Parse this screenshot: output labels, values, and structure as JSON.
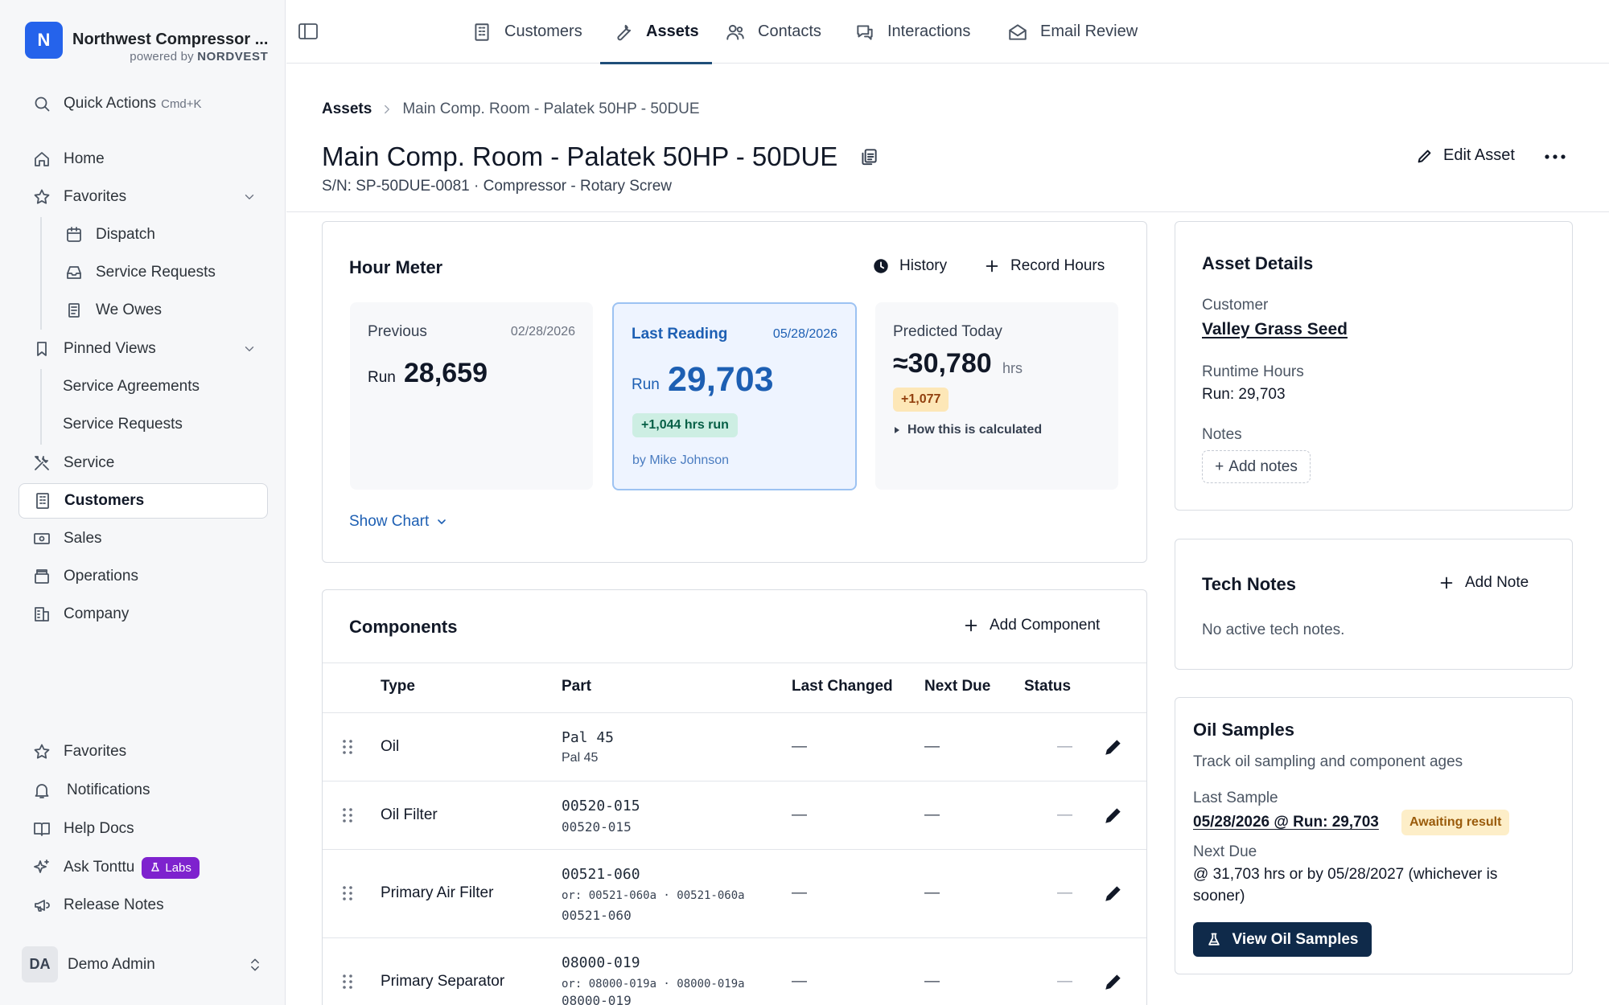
{
  "brand": {
    "logo_letter": "N",
    "name": "Northwest Compressor ...",
    "powered_prefix": "powered by",
    "powered_brand": "NORDVEST",
    "accent": "#2563eb"
  },
  "sidebar": {
    "quick_actions": {
      "label": "Quick Actions",
      "shortcut": "Cmd+K"
    },
    "home": "Home",
    "favorites": "Favorites",
    "favorites_items": [
      "Dispatch",
      "Service Requests",
      "We Owes"
    ],
    "pinned_views": "Pinned Views",
    "pinned_items": [
      "Service Agreements",
      "Service Requests"
    ],
    "service": "Service",
    "customers": "Customers",
    "sales": "Sales",
    "operations": "Operations",
    "company": "Company",
    "bottom": {
      "favorites": "Favorites",
      "notifications": "Notifications",
      "help_docs": "Help Docs",
      "ask": "Ask Tonttu",
      "labs_badge": "Labs",
      "release_notes": "Release Notes"
    },
    "user": {
      "initials": "DA",
      "name": "Demo Admin"
    }
  },
  "topnav": {
    "tabs": [
      {
        "label": "Customers",
        "icon": "building-icon"
      },
      {
        "label": "Assets",
        "icon": "wrench-icon",
        "active": true
      },
      {
        "label": "Contacts",
        "icon": "users-icon"
      },
      {
        "label": "Interactions",
        "icon": "chat-icon"
      },
      {
        "label": "Email Review",
        "icon": "mail-open-icon"
      }
    ]
  },
  "breadcrumb": {
    "root": "Assets",
    "current": "Main Comp. Room - Palatek 50HP - 50DUE"
  },
  "header": {
    "title": "Main Comp. Room - Palatek 50HP - 50DUE",
    "subtitle": "S/N: SP-50DUE-0081 · Compressor - Rotary Screw",
    "edit_label": "Edit Asset"
  },
  "hour_meter": {
    "title": "Hour Meter",
    "history_label": "History",
    "record_label": "Record Hours",
    "previous": {
      "label": "Previous",
      "date": "02/28/2026",
      "run_label": "Run",
      "value": "28,659"
    },
    "last": {
      "label": "Last Reading",
      "date": "05/28/2026",
      "run_label": "Run",
      "value": "29,703",
      "delta": "+1,044 hrs run",
      "by": "by Mike Johnson"
    },
    "predicted": {
      "label": "Predicted Today",
      "value": "≈30,780",
      "unit": "hrs",
      "delta": "+1,077",
      "how": "How this is calculated"
    },
    "show_chart": "Show Chart"
  },
  "components": {
    "title": "Components",
    "add_label": "Add Component",
    "columns": [
      "Type",
      "Part",
      "Last Changed",
      "Next Due",
      "Status"
    ],
    "rows": [
      {
        "type": "Oil",
        "part": "Pal 45",
        "sub": "Pal 45",
        "alt": "",
        "last_changed": "—",
        "next_due": "—",
        "status": "—"
      },
      {
        "type": "Oil Filter",
        "part": "00520-015",
        "sub": "00520-015",
        "alt": "",
        "last_changed": "—",
        "next_due": "—",
        "status": "—"
      },
      {
        "type": "Primary Air Filter",
        "part": "00521-060",
        "sub": "or: 00521-060a · 00521-060a",
        "alt": "00521-060",
        "last_changed": "—",
        "next_due": "—",
        "status": "—"
      },
      {
        "type": "Primary Separator",
        "part": "08000-019",
        "sub": "or: 08000-019a · 08000-019a",
        "alt": "08000-019",
        "last_changed": "—",
        "next_due": "—",
        "status": "—"
      }
    ]
  },
  "asset_details": {
    "title": "Asset Details",
    "customer_label": "Customer",
    "customer_value": "Valley Grass Seed",
    "runtime_label": "Runtime Hours",
    "runtime_value": "Run: 29,703",
    "notes_label": "Notes",
    "add_notes": "Add notes"
  },
  "tech_notes": {
    "title": "Tech Notes",
    "add_label": "Add Note",
    "empty": "No active tech notes."
  },
  "oil_samples": {
    "title": "Oil Samples",
    "description": "Track oil sampling and component ages",
    "last_label": "Last Sample",
    "last_value": "05/28/2026 @ Run: 29,703",
    "status_badge": "Awaiting result",
    "next_label": "Next Due",
    "next_value_line1": "@ 31,703 hrs or by 05/28/2027 (whichever is",
    "next_value_line2": "sooner)",
    "button": "View Oil Samples"
  }
}
